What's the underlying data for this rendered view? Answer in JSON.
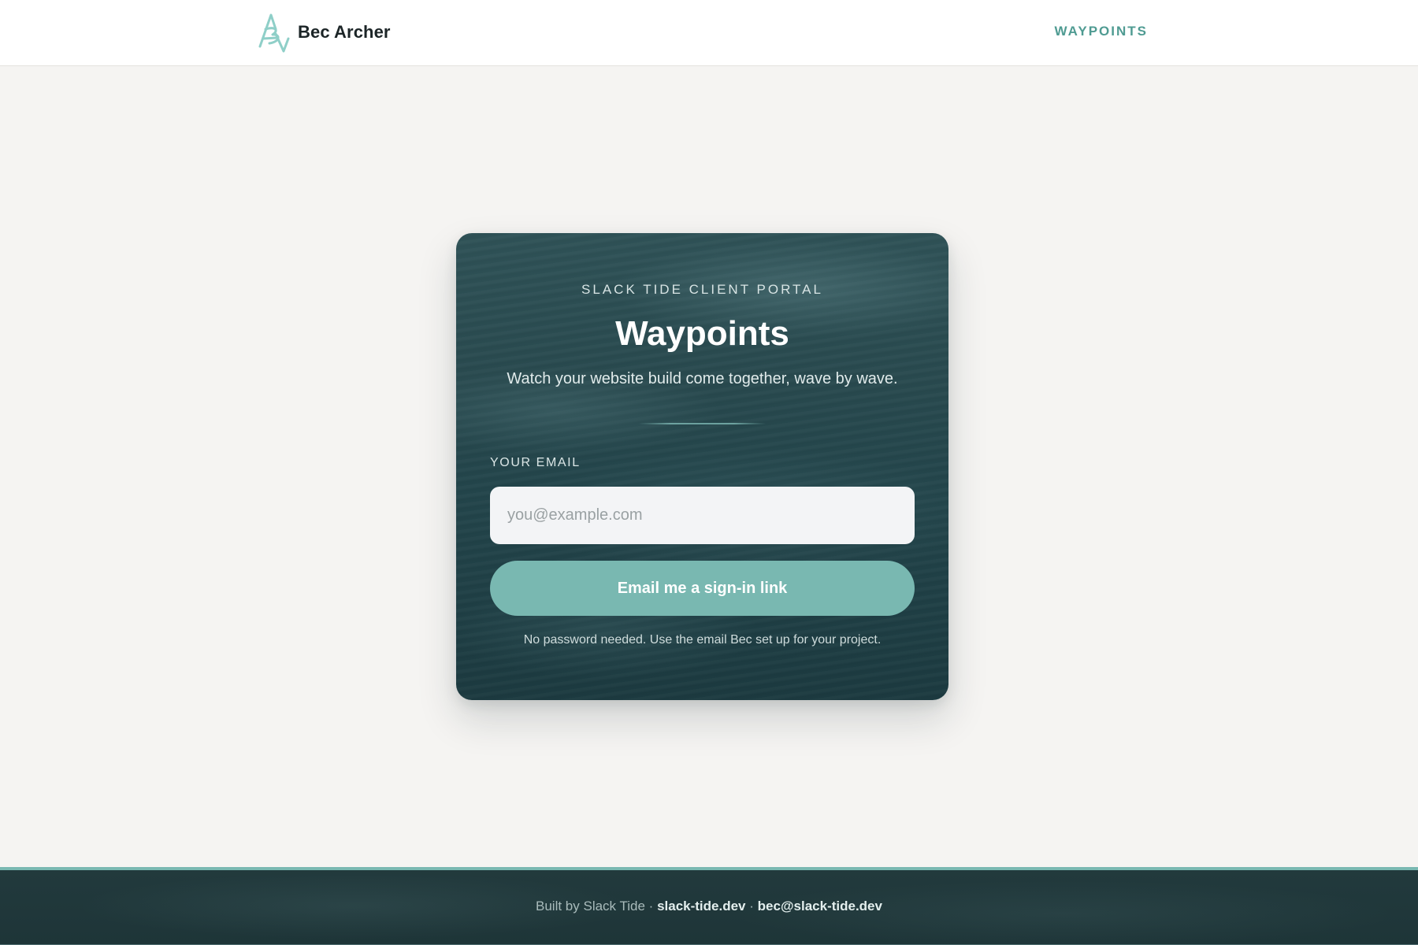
{
  "header": {
    "brand_name": "Bec Archer",
    "logo_icon": "ba-monogram-logo",
    "nav_link_label": "WAYPOINTS"
  },
  "card": {
    "eyebrow": "SLACK TIDE CLIENT PORTAL",
    "title": "Waypoints",
    "subtitle": "Watch your website build come together, wave by wave.",
    "email_label": "YOUR EMAIL",
    "email_placeholder": "you@example.com",
    "email_value": "",
    "submit_label": "Email me a sign-in link",
    "helper_text": "No password needed. Use the email Bec set up for your project."
  },
  "footer": {
    "built_by": "Built by Slack Tide",
    "separator": "·",
    "site_link": "slack-tide.dev",
    "email_link": "bec@slack-tide.dev"
  },
  "colors": {
    "accent": "#79b8b1",
    "nav_link": "#4f9b92",
    "card_bg": "#24464b",
    "page_bg": "#f5f4f2",
    "footer_bg": "#1f3639"
  }
}
